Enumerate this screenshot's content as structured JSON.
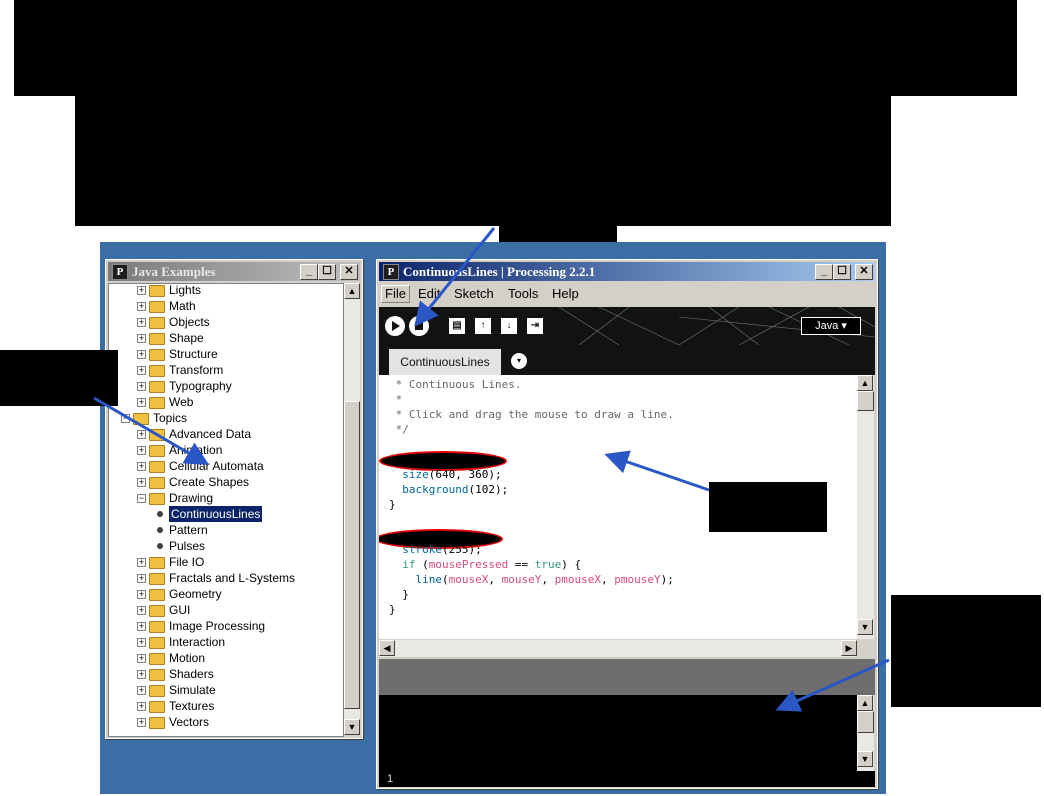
{
  "colors": {
    "arrow": "#2a56c6",
    "desktop": "#3a6ea5",
    "selection": "#0a246a",
    "redaction-outline": "#e00000"
  },
  "examples_window": {
    "icon_letter": "P",
    "title": "Java Examples",
    "buttons": {
      "minimize": "_",
      "maximize": "☐",
      "close": "✕"
    },
    "tree": [
      {
        "label": "Lights",
        "level": 1,
        "type": "folder"
      },
      {
        "label": "Math",
        "level": 1,
        "type": "folder"
      },
      {
        "label": "Objects",
        "level": 1,
        "type": "folder"
      },
      {
        "label": "Shape",
        "level": 1,
        "type": "folder"
      },
      {
        "label": "Structure",
        "level": 1,
        "type": "folder"
      },
      {
        "label": "Transform",
        "level": 1,
        "type": "folder"
      },
      {
        "label": "Typography",
        "level": 1,
        "type": "folder"
      },
      {
        "label": "Web",
        "level": 1,
        "type": "folder"
      },
      {
        "label": "Topics",
        "level": 0,
        "type": "folder",
        "expanded": true
      },
      {
        "label": "Advanced Data",
        "level": 1,
        "type": "folder"
      },
      {
        "label": "Animation",
        "level": 1,
        "type": "folder"
      },
      {
        "label": "Cellular Automata",
        "level": 1,
        "type": "folder"
      },
      {
        "label": "Create Shapes",
        "level": 1,
        "type": "folder"
      },
      {
        "label": "Drawing",
        "level": 1,
        "type": "folder",
        "expanded": true
      },
      {
        "label": "ContinuousLines",
        "level": 2,
        "type": "leaf",
        "selected": true
      },
      {
        "label": "Pattern",
        "level": 2,
        "type": "leaf"
      },
      {
        "label": "Pulses",
        "level": 2,
        "type": "leaf"
      },
      {
        "label": "File IO",
        "level": 1,
        "type": "folder"
      },
      {
        "label": "Fractals and L-Systems",
        "level": 1,
        "type": "folder"
      },
      {
        "label": "Geometry",
        "level": 1,
        "type": "folder"
      },
      {
        "label": "GUI",
        "level": 1,
        "type": "folder"
      },
      {
        "label": "Image Processing",
        "level": 1,
        "type": "folder"
      },
      {
        "label": "Interaction",
        "level": 1,
        "type": "folder"
      },
      {
        "label": "Motion",
        "level": 1,
        "type": "folder"
      },
      {
        "label": "Shaders",
        "level": 1,
        "type": "folder"
      },
      {
        "label": "Simulate",
        "level": 1,
        "type": "folder"
      },
      {
        "label": "Textures",
        "level": 1,
        "type": "folder"
      },
      {
        "label": "Vectors",
        "level": 1,
        "type": "folder"
      }
    ]
  },
  "processing_window": {
    "icon_letter": "P",
    "title": "ContinuousLines | Processing 2.2.1",
    "buttons": {
      "minimize": "_",
      "maximize": "☐",
      "close": "✕"
    },
    "menu": [
      "File",
      "Edit",
      "Sketch",
      "Tools",
      "Help"
    ],
    "toolbar": {
      "new_glyph": "▤",
      "open_glyph": "↑",
      "save_glyph": "↓",
      "export_glyph": "⇥",
      "mode": "Java ▾"
    },
    "tab": "ContinuousLines",
    "tab_menu_glyph": "▾",
    "line_number": "1",
    "code": [
      [
        {
          "t": " * Continuous Lines.",
          "c": "c-comment"
        }
      ],
      [
        {
          "t": " *",
          "c": "c-comment"
        }
      ],
      [
        {
          "t": " * Click and drag the mouse to draw a line.",
          "c": "c-comment"
        }
      ],
      [
        {
          "t": " */",
          "c": "c-comment"
        }
      ],
      [],
      [],
      [
        {
          "t": "  ",
          "c": "c-plain"
        },
        {
          "t": "size",
          "c": "c-fn"
        },
        {
          "t": "(640, 360);",
          "c": "c-plain"
        }
      ],
      [
        {
          "t": "  ",
          "c": "c-plain"
        },
        {
          "t": "background",
          "c": "c-fn"
        },
        {
          "t": "(102);",
          "c": "c-plain"
        }
      ],
      [
        {
          "t": "}",
          "c": "c-plain"
        }
      ],
      [],
      [],
      [
        {
          "t": "  ",
          "c": "c-plain"
        },
        {
          "t": "stroke",
          "c": "c-fn"
        },
        {
          "t": "(255);",
          "c": "c-plain"
        }
      ],
      [
        {
          "t": "  ",
          "c": "c-plain"
        },
        {
          "t": "if",
          "c": "c-kw"
        },
        {
          "t": " (",
          "c": "c-plain"
        },
        {
          "t": "mousePressed",
          "c": "c-var"
        },
        {
          "t": " == ",
          "c": "c-plain"
        },
        {
          "t": "true",
          "c": "c-kw"
        },
        {
          "t": ") {",
          "c": "c-plain"
        }
      ],
      [
        {
          "t": "    ",
          "c": "c-plain"
        },
        {
          "t": "line",
          "c": "c-fn"
        },
        {
          "t": "(",
          "c": "c-plain"
        },
        {
          "t": "mouseX",
          "c": "c-var"
        },
        {
          "t": ", ",
          "c": "c-plain"
        },
        {
          "t": "mouseY",
          "c": "c-var"
        },
        {
          "t": ", ",
          "c": "c-plain"
        },
        {
          "t": "pmouseX",
          "c": "c-var"
        },
        {
          "t": ", ",
          "c": "c-plain"
        },
        {
          "t": "pmouseY",
          "c": "c-var"
        },
        {
          "t": ");",
          "c": "c-plain"
        }
      ],
      [
        {
          "t": "  }",
          "c": "c-plain"
        }
      ],
      [
        {
          "t": "}",
          "c": "c-plain"
        }
      ]
    ]
  },
  "scroll_glyphs": {
    "up": "▲",
    "down": "▼",
    "left": "◀",
    "right": "▶"
  }
}
